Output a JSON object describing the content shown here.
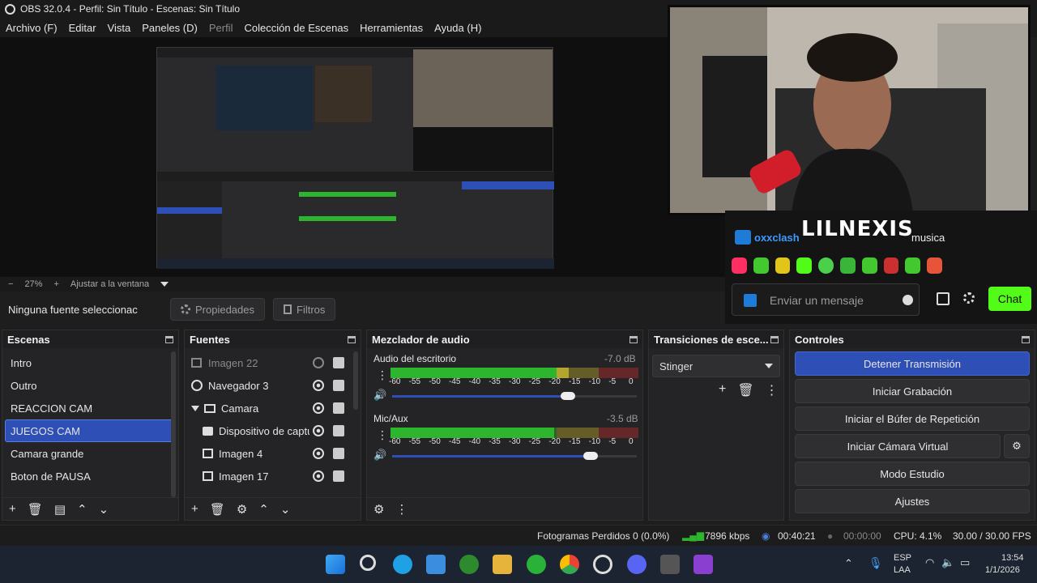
{
  "window": {
    "title": "OBS 32.0.4 - Perfil: Sin Título - Escenas: Sin Título"
  },
  "menu": [
    "Archivo (F)",
    "Editar",
    "Vista",
    "Paneles (D)",
    "Perfil",
    "Colección de Escenas",
    "Herramientas",
    "Ayuda (H)"
  ],
  "preview": {
    "zoom": "27%",
    "fit_label": "Ajustar a la ventana",
    "overlay_name": "LILNEXIS",
    "chat_user": "oxxclash",
    "chat_text": "musica",
    "chat_placeholder": "Enviar un mensaje",
    "chat_button": "Chat"
  },
  "source_toolbar": {
    "no_source": "Ninguna fuente seleccionac",
    "properties": "Propiedades",
    "filters": "Filtros"
  },
  "scenes": {
    "title": "Escenas",
    "items": [
      "Intro",
      "Outro",
      "REACCION CAM",
      "JUEGOS CAM",
      "Camara grande",
      "Boton de PAUSA"
    ],
    "selected": "JUEGOS CAM"
  },
  "sources": {
    "title": "Fuentes",
    "items": [
      "Imagen 22",
      "Navegador 3",
      "Camara",
      "Dispositivo de captu",
      "Imagen 4",
      "Imagen 17"
    ]
  },
  "mixer": {
    "title": "Mezclador de audio",
    "channels": [
      {
        "name": "Audio del escritorio",
        "db": "-7.0 dB",
        "level": 0.72,
        "volume": 0.72
      },
      {
        "name": "Mic/Aux",
        "db": "-3.5 dB",
        "level": 0.66,
        "volume": 0.81
      }
    ],
    "scale": [
      "-60",
      "-55",
      "-50",
      "-45",
      "-40",
      "-35",
      "-30",
      "-25",
      "-20",
      "-15",
      "-10",
      "-5",
      "0"
    ]
  },
  "transitions": {
    "title": "Transiciones de esce...",
    "selected": "Stinger"
  },
  "controls": {
    "title": "Controles",
    "buttons": [
      "Detener Transmisión",
      "Iniciar Grabación",
      "Iniciar el Búfer de Repetición",
      "Iniciar Cámara Virtual",
      "Modo Estudio",
      "Ajustes"
    ]
  },
  "status": {
    "dropped": "Fotogramas Perdidos 0 (0.0%)",
    "bitrate": "7896 kbps",
    "stream_time": "00:40:21",
    "rec_time": "00:00:00",
    "cpu": "CPU: 4.1%",
    "fps": "30.00 / 30.00 FPS"
  },
  "taskbar": {
    "lang1": "ESP",
    "lang2": "LAA",
    "time": "13:54",
    "date": "1/1/2026"
  },
  "colors": {
    "accent": "#2e4fb5",
    "meter_green": "#2db52d",
    "meter_yellow": "#b5a52d",
    "meter_red": "#b52d2d",
    "chat_green": "#53fc18"
  }
}
